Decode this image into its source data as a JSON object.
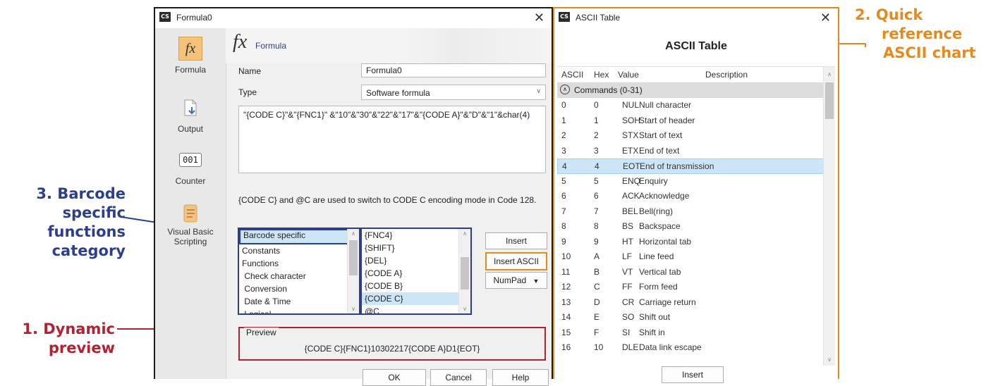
{
  "callouts": {
    "quick_reference": [
      "2. Quick",
      "reference",
      "ASCII chart"
    ],
    "barcode_specific": [
      "3. Barcode",
      "specific",
      "functions",
      "category"
    ],
    "dynamic_preview": [
      "1. Dynamic",
      "preview"
    ]
  },
  "colors": {
    "orange": "#e68a1e",
    "blue": "#2c3f8f",
    "red": "#b32230"
  },
  "formula_window": {
    "title": "Formula0",
    "app_icon": "CS",
    "close_glyph": "✕",
    "nav": [
      {
        "label": "Formula",
        "icon": "fx-icon"
      },
      {
        "label": "Output",
        "icon": "output-icon"
      },
      {
        "label": "Counter",
        "icon": "counter-icon"
      },
      {
        "label": "Visual Basic Scripting",
        "icon": "script-icon"
      }
    ],
    "counter_glyph": "001",
    "banner_title": "Formula",
    "name_label": "Name",
    "name_value": "Formula0",
    "type_label": "Type",
    "type_value": "Software formula",
    "expression": "\"{CODE C}\"&\"{FNC1}\" &\"10\"&\"30\"&\"22\"&\"17\"&\"{CODE A}\"&\"D\"&\"1\"&char(4)",
    "info_text": "{CODE C} and @C  are used to switch to CODE C encoding mode in Code 128.",
    "categories": [
      "Barcode specific",
      "Constants",
      "Functions",
      " Check character",
      " Conversion",
      " Date & Time",
      " Logical"
    ],
    "functions": [
      "{FNC4}",
      "{SHIFT}",
      "{DEL}",
      "{CODE A}",
      "{CODE B}",
      "{CODE C}",
      "@C"
    ],
    "insert_label": "Insert",
    "insert_ascii_label": "Insert ASCII",
    "numpad_label": "NumPad",
    "preview_label": "Preview",
    "preview_value": "{CODE C}{FNC1}10302217{CODE A}D1{EOT}",
    "ok_label": "OK",
    "cancel_label": "Cancel",
    "help_label": "Help"
  },
  "ascii_window": {
    "title": "ASCII Table",
    "app_icon": "CS",
    "close_glyph": "✕",
    "heading": "ASCII Table",
    "columns": [
      "ASCII",
      "Hex",
      "Value",
      "Description"
    ],
    "group_label": "Commands (0-31)",
    "rows": [
      [
        "0",
        "0",
        "NUL",
        "Null character"
      ],
      [
        "1",
        "1",
        "SOH",
        "Start of header"
      ],
      [
        "2",
        "2",
        "STX",
        "Start of text"
      ],
      [
        "3",
        "3",
        "ETX",
        "End of text"
      ],
      [
        "4",
        "4",
        "EOT",
        "End of transmission"
      ],
      [
        "5",
        "5",
        "ENQ",
        "Enquiry"
      ],
      [
        "6",
        "6",
        "ACK",
        "Acknowledge"
      ],
      [
        "7",
        "7",
        "BEL",
        "Bell(ring)"
      ],
      [
        "8",
        "8",
        "BS",
        "Backspace"
      ],
      [
        "9",
        "9",
        "HT",
        "Horizontal tab"
      ],
      [
        "10",
        "A",
        "LF",
        "Line feed"
      ],
      [
        "11",
        "B",
        "VT",
        "Vertical tab"
      ],
      [
        "12",
        "C",
        "FF",
        "Form feed"
      ],
      [
        "13",
        "D",
        "CR",
        "Carriage return"
      ],
      [
        "14",
        "E",
        "SO",
        "Shift out"
      ],
      [
        "15",
        "F",
        "SI",
        "Shift in"
      ],
      [
        "16",
        "10",
        "DLE",
        "Data link escape"
      ]
    ],
    "selected_row": 4,
    "insert_label": "Insert"
  }
}
